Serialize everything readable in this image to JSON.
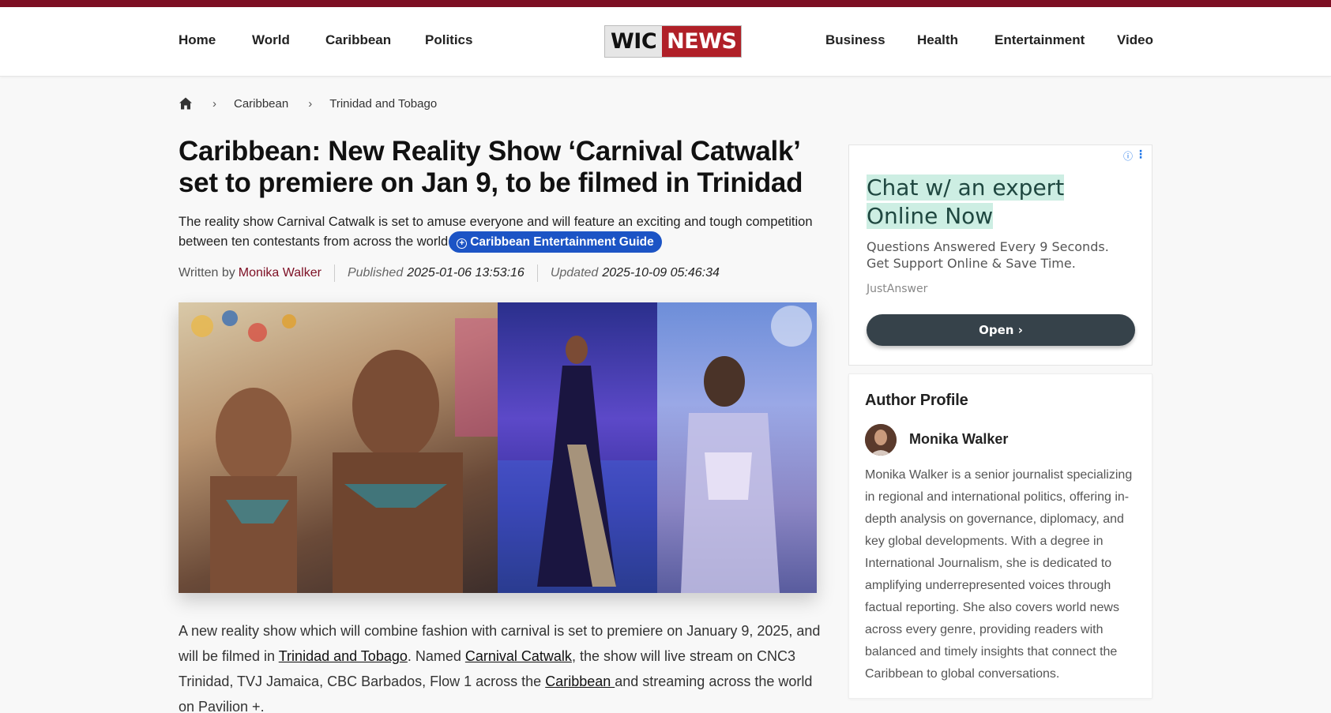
{
  "header": {
    "nav_left": [
      "Home",
      "World",
      "Caribbean",
      "Politics"
    ],
    "nav_right": [
      "Business",
      "Health",
      "Entertainment",
      "Video"
    ],
    "logo": {
      "part1": "WIC",
      "part2": "NEWS"
    }
  },
  "breadcrumb": {
    "items": [
      "Caribbean",
      "Trinidad and Tobago"
    ]
  },
  "article": {
    "title": "Caribbean: New Reality Show ‘Carnival Catwalk’ set to premiere on Jan 9, to be filmed in Trinidad",
    "subtitle": "The reality show Carnival Catwalk is set to amuse everyone and will feature an exciting and tough competition between ten contestants from across the world",
    "guide_pill": "Caribbean Entertainment Guide",
    "meta": {
      "written_by_label": "Written by",
      "author": "Monika Walker",
      "published_label": "Published",
      "published": "2025-01-06 13:53:16",
      "updated_label": "Updated",
      "updated": "2025-10-09 05:46:34"
    },
    "body": {
      "p1_a": "A new reality show which will combine fashion with carnival is set to premiere on January 9, 2025, and will be filmed in ",
      "link1": "Trinidad and Tobago",
      "p1_b": ". Named ",
      "link2": "Carnival Catwalk",
      "p1_c": ", the show will live stream on CNC3 Trinidad, TVJ Jamaica, CBC Barbados, Flow 1 across the ",
      "link3": "Caribbean ",
      "p1_d": "and streaming across the world on Pavilion +."
    }
  },
  "ad": {
    "headline": "Chat w/ an expert Online Now",
    "description": "Questions Answered Every 9 Seconds. Get Support Online & Save Time.",
    "source": "JustAnswer",
    "button": "Open"
  },
  "author_profile": {
    "heading": "Author Profile",
    "name": "Monika Walker",
    "bio": "Monika Walker is a senior journalist specializing in regional and international politics, offering in-depth analysis on governance, diplomacy, and key global developments. With a degree in International Journalism, she is dedicated to amplifying underrepresented voices through factual reporting. She also covers world news across every genre, providing readers with balanced and timely insights that connect the Caribbean to global conversations."
  },
  "colors": {
    "brand": "#7d0f24",
    "logo_red": "#b02028",
    "pill_blue": "#1c54c5",
    "ad_button": "#36424a"
  }
}
